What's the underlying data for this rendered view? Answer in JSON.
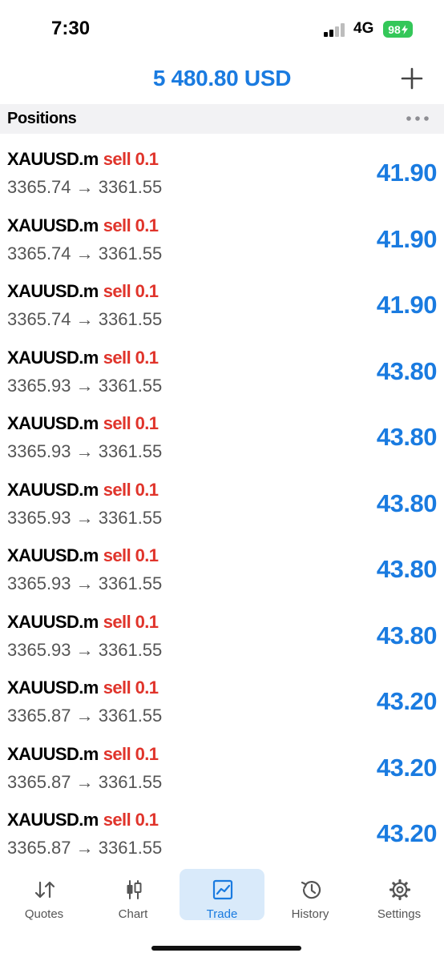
{
  "status_bar": {
    "time": "7:30",
    "network": "4G",
    "battery": "98"
  },
  "header": {
    "balance": "5 480.80 USD"
  },
  "section": {
    "title": "Positions"
  },
  "positions": [
    {
      "symbol": "XAUUSD.m",
      "direction": "sell 0.1",
      "prices": "3365.74 → 3361.55",
      "profit": "41.90"
    },
    {
      "symbol": "XAUUSD.m",
      "direction": "sell 0.1",
      "prices": "3365.74 → 3361.55",
      "profit": "41.90"
    },
    {
      "symbol": "XAUUSD.m",
      "direction": "sell 0.1",
      "prices": "3365.74 → 3361.55",
      "profit": "41.90"
    },
    {
      "symbol": "XAUUSD.m",
      "direction": "sell 0.1",
      "prices": "3365.93 → 3361.55",
      "profit": "43.80"
    },
    {
      "symbol": "XAUUSD.m",
      "direction": "sell 0.1",
      "prices": "3365.93 → 3361.55",
      "profit": "43.80"
    },
    {
      "symbol": "XAUUSD.m",
      "direction": "sell 0.1",
      "prices": "3365.93 → 3361.55",
      "profit": "43.80"
    },
    {
      "symbol": "XAUUSD.m",
      "direction": "sell 0.1",
      "prices": "3365.93 → 3361.55",
      "profit": "43.80"
    },
    {
      "symbol": "XAUUSD.m",
      "direction": "sell 0.1",
      "prices": "3365.93 → 3361.55",
      "profit": "43.80"
    },
    {
      "symbol": "XAUUSD.m",
      "direction": "sell 0.1",
      "prices": "3365.87 → 3361.55",
      "profit": "43.20"
    },
    {
      "symbol": "XAUUSD.m",
      "direction": "sell 0.1",
      "prices": "3365.87 → 3361.55",
      "profit": "43.20"
    },
    {
      "symbol": "XAUUSD.m",
      "direction": "sell 0.1",
      "prices": "3365.87 → 3361.55",
      "profit": "43.20"
    }
  ],
  "tabs": [
    {
      "label": "Quotes",
      "icon": "quotes-icon"
    },
    {
      "label": "Chart",
      "icon": "chart-icon"
    },
    {
      "label": "Trade",
      "icon": "trade-icon",
      "active": true
    },
    {
      "label": "History",
      "icon": "history-icon"
    },
    {
      "label": "Settings",
      "icon": "settings-icon"
    }
  ],
  "colors": {
    "accent": "#1a7be0",
    "sell": "#e0342b",
    "active_tab_bg": "#d9eafa",
    "battery": "#34c759"
  }
}
